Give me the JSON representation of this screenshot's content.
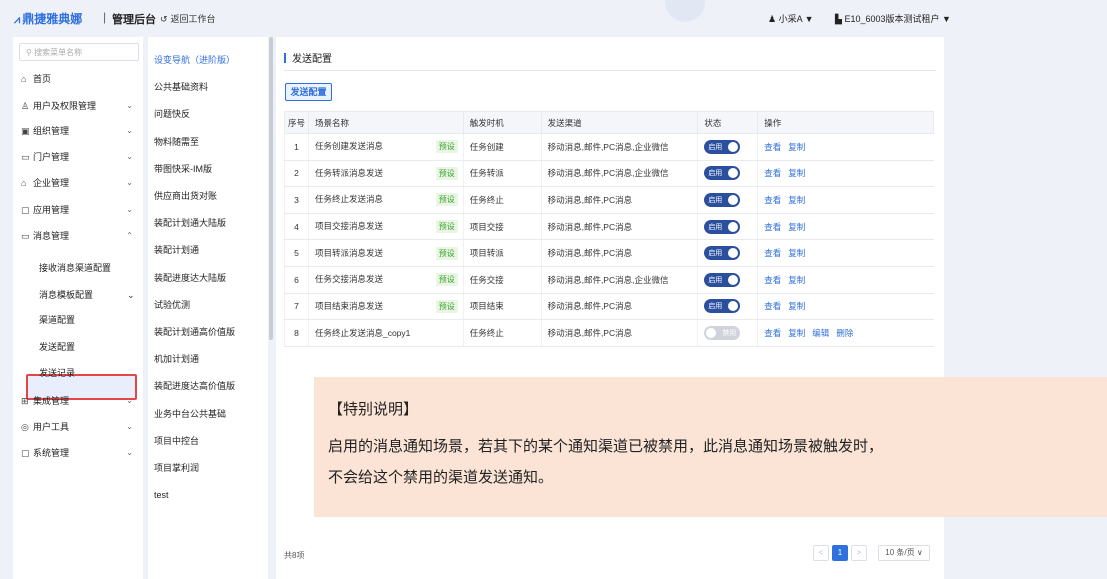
{
  "topbar": {
    "brand": "鼎捷雅典娜",
    "divider": "|",
    "admin": "管理后台",
    "back": "返回工作台",
    "user": "小采A ▼",
    "tenant": "E10_6003版本测试租户 ▼"
  },
  "sidebar": {
    "search_placeholder": "搜索菜单名称",
    "items": [
      {
        "label": "首页",
        "icon": "home-icon",
        "glyph": "⌂",
        "arrow": ""
      },
      {
        "label": "用户及权限管理",
        "icon": "users-icon",
        "glyph": "♙",
        "arrow": "⌄"
      },
      {
        "label": "组织管理",
        "icon": "org-icon",
        "glyph": "▣",
        "arrow": "⌄"
      },
      {
        "label": "门户管理",
        "icon": "portal-icon",
        "glyph": "▭",
        "arrow": "⌄"
      },
      {
        "label": "企业管理",
        "icon": "building-icon",
        "glyph": "⌂",
        "arrow": "⌄"
      },
      {
        "label": "应用管理",
        "icon": "app-icon",
        "glyph": "▢",
        "arrow": "⌄"
      },
      {
        "label": "消息管理",
        "icon": "message-icon",
        "glyph": "▭",
        "arrow": "⌃"
      }
    ],
    "subitems": [
      {
        "label": "接收消息渠道配置",
        "arrow": ""
      },
      {
        "label": "消息模板配置",
        "arrow": "⌄"
      },
      {
        "label": "渠道配置",
        "arrow": ""
      },
      {
        "label": "发送配置",
        "arrow": ""
      },
      {
        "label": "发送记录",
        "arrow": ""
      }
    ],
    "items2": [
      {
        "label": "集成管理",
        "icon": "integration-icon",
        "glyph": "⊞",
        "arrow": "⌄"
      },
      {
        "label": "用户工具",
        "icon": "tool-icon",
        "glyph": "◎",
        "arrow": "⌄"
      },
      {
        "label": "系统管理",
        "icon": "system-icon",
        "glyph": "▢",
        "arrow": "⌄"
      }
    ]
  },
  "midmenu": {
    "items": [
      "设变导航（进阶版）",
      "公共基础资料",
      "问题快反",
      "物料随需至",
      "带图快采-IM版",
      "供应商出货对账",
      "装配计划通大陆版",
      "装配计划通",
      "装配进度达大陆版",
      "试验优测",
      "装配计划通高价值版",
      "机加计划通",
      "装配进度达高价值版",
      "业务中台公共基础",
      "项目中控台",
      "项目掌利润",
      "test"
    ]
  },
  "main": {
    "title": "发送配置",
    "tab": "发送配置",
    "columns": [
      "序号",
      "场景名称",
      "触发时机",
      "发送渠道",
      "状态",
      "操作"
    ],
    "rows": [
      {
        "idx": "1",
        "name": "任务创建发送消息",
        "preset": "预设",
        "trigger": "任务创建",
        "channel": "移动消息,邮件,PC消息,企业微信",
        "status": "启用",
        "on": true,
        "ops": [
          "查看",
          "复制"
        ]
      },
      {
        "idx": "2",
        "name": "任务转派消息发送",
        "preset": "预设",
        "trigger": "任务转派",
        "channel": "移动消息,邮件,PC消息,企业微信",
        "status": "启用",
        "on": true,
        "ops": [
          "查看",
          "复制"
        ]
      },
      {
        "idx": "3",
        "name": "任务终止发送消息",
        "preset": "预设",
        "trigger": "任务终止",
        "channel": "移动消息,邮件,PC消息",
        "status": "启用",
        "on": true,
        "ops": [
          "查看",
          "复制"
        ]
      },
      {
        "idx": "4",
        "name": "项目交接消息发送",
        "preset": "预设",
        "trigger": "项目交接",
        "channel": "移动消息,邮件,PC消息",
        "status": "启用",
        "on": true,
        "ops": [
          "查看",
          "复制"
        ]
      },
      {
        "idx": "5",
        "name": "项目转派消息发送",
        "preset": "预设",
        "trigger": "项目转派",
        "channel": "移动消息,邮件,PC消息",
        "status": "启用",
        "on": true,
        "ops": [
          "查看",
          "复制"
        ]
      },
      {
        "idx": "6",
        "name": "任务交接消息发送",
        "preset": "预设",
        "trigger": "任务交接",
        "channel": "移动消息,邮件,PC消息,企业微信",
        "status": "启用",
        "on": true,
        "ops": [
          "查看",
          "复制"
        ]
      },
      {
        "idx": "7",
        "name": "项目结束消息发送",
        "preset": "预设",
        "trigger": "项目结束",
        "channel": "移动消息,邮件,PC消息",
        "status": "启用",
        "on": true,
        "ops": [
          "查看",
          "复制"
        ]
      },
      {
        "idx": "8",
        "name": "任务终止发送消息_copy1",
        "preset": "",
        "trigger": "任务终止",
        "channel": "移动消息,邮件,PC消息",
        "status": "禁用",
        "on": false,
        "ops": [
          "查看",
          "复制",
          "编辑",
          "删除"
        ]
      }
    ],
    "total": "共8项",
    "pager": {
      "prev": "<",
      "page": "1",
      "next": ">",
      "size": "10 条/页 ∨"
    }
  },
  "note": {
    "heading": "【特别说明】",
    "line1": "启用的消息通知场景，若其下的某个通知渠道已被禁用，此消息通知场景被触发时，",
    "line2": "不会给这个禁用的渠道发送通知。"
  },
  "colors": {
    "accent": "#2f6fde",
    "toggle_on": "#2b4f9f",
    "highlight": "#e64545",
    "note_bg": "#fbe4d6"
  }
}
